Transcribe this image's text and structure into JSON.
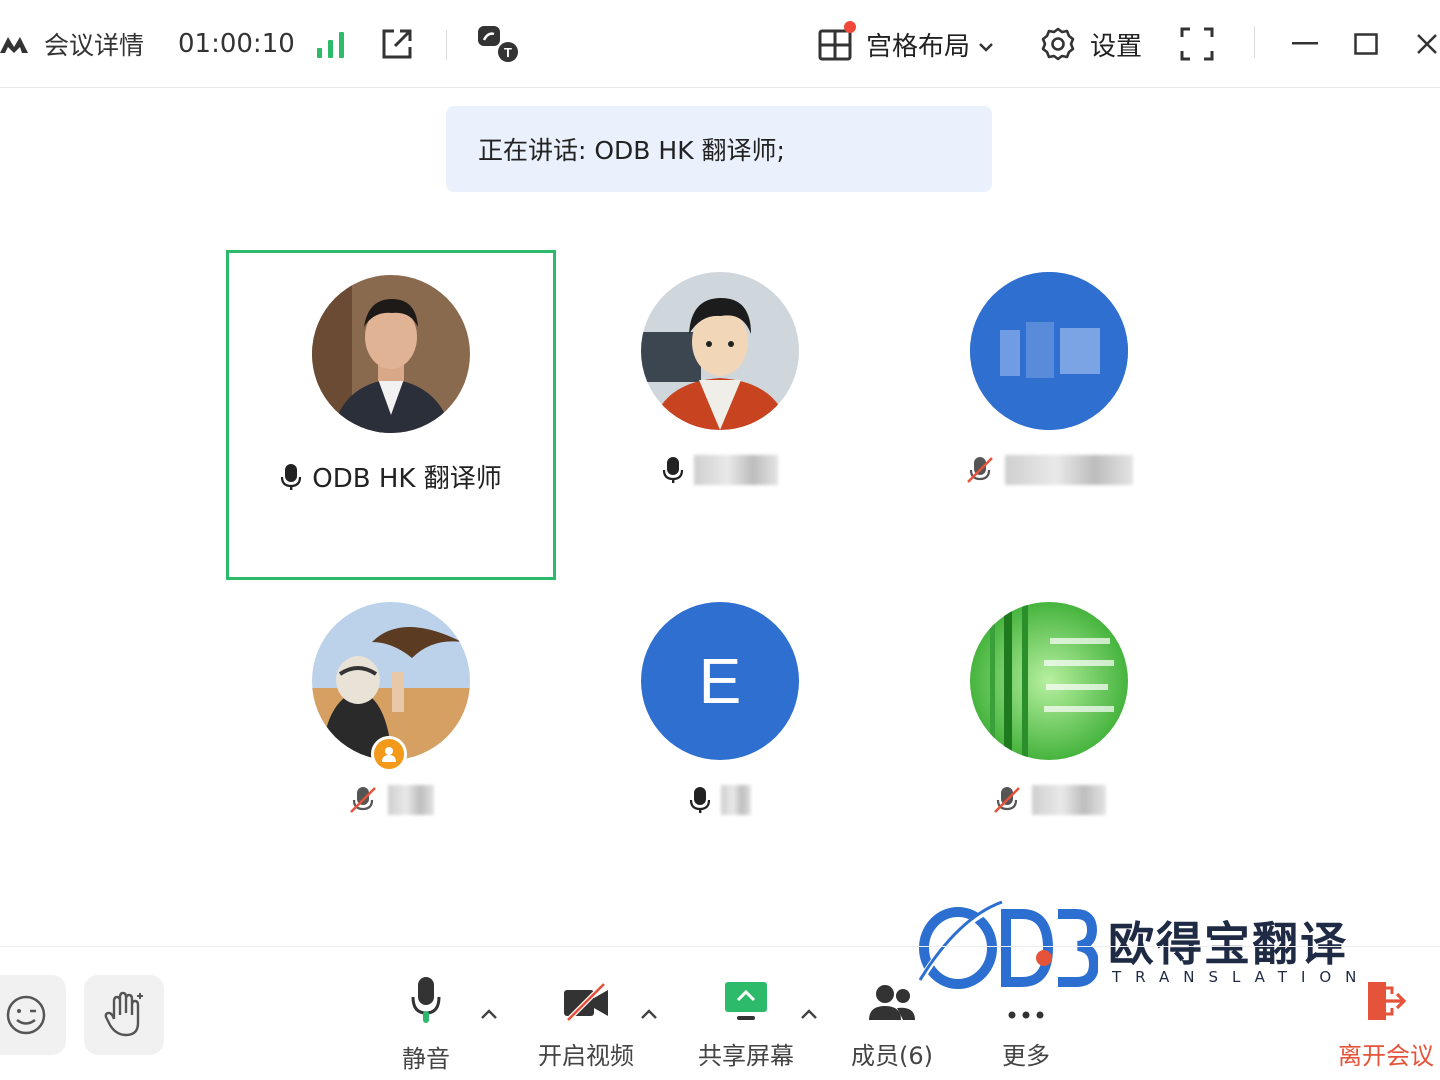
{
  "titlebar": {
    "meeting_detail": "会议详情",
    "timer": "01:00:10",
    "layout_label": "宫格布局",
    "settings_label": "设置"
  },
  "banner": {
    "speaking_text": "正在讲话: ODB HK 翻译师;"
  },
  "participants": [
    {
      "name": "ODB HK 翻译师",
      "mic": "on",
      "avatar": "photo-man-suit",
      "speaking": true
    },
    {
      "name": "",
      "mic": "on",
      "avatar": "cartoon-character"
    },
    {
      "name": "",
      "mic": "muted",
      "avatar": "blurred-blue"
    },
    {
      "name": "",
      "mic": "muted",
      "avatar": "photo-falconer",
      "host": true
    },
    {
      "name": "",
      "mic": "on",
      "avatar": "letter",
      "letter": "E"
    },
    {
      "name": "",
      "mic": "muted",
      "avatar": "bamboo-green"
    }
  ],
  "toolbar": {
    "mute_label": "静音",
    "video_label": "开启视频",
    "share_label": "共享屏幕",
    "members_label": "成员(6)",
    "more_label": "更多",
    "leave_label": "离开会议"
  },
  "watermark": {
    "cn": "欧得宝翻译",
    "en": "TRANSLATION"
  },
  "colors": {
    "active_border": "#2dbb6b",
    "banner_bg": "#eaf1fd",
    "avatar_blue": "#2f6fd0",
    "leave_red": "#e5533a",
    "signal_green": "#2dbb6b",
    "host_orange": "#f39a1b"
  }
}
